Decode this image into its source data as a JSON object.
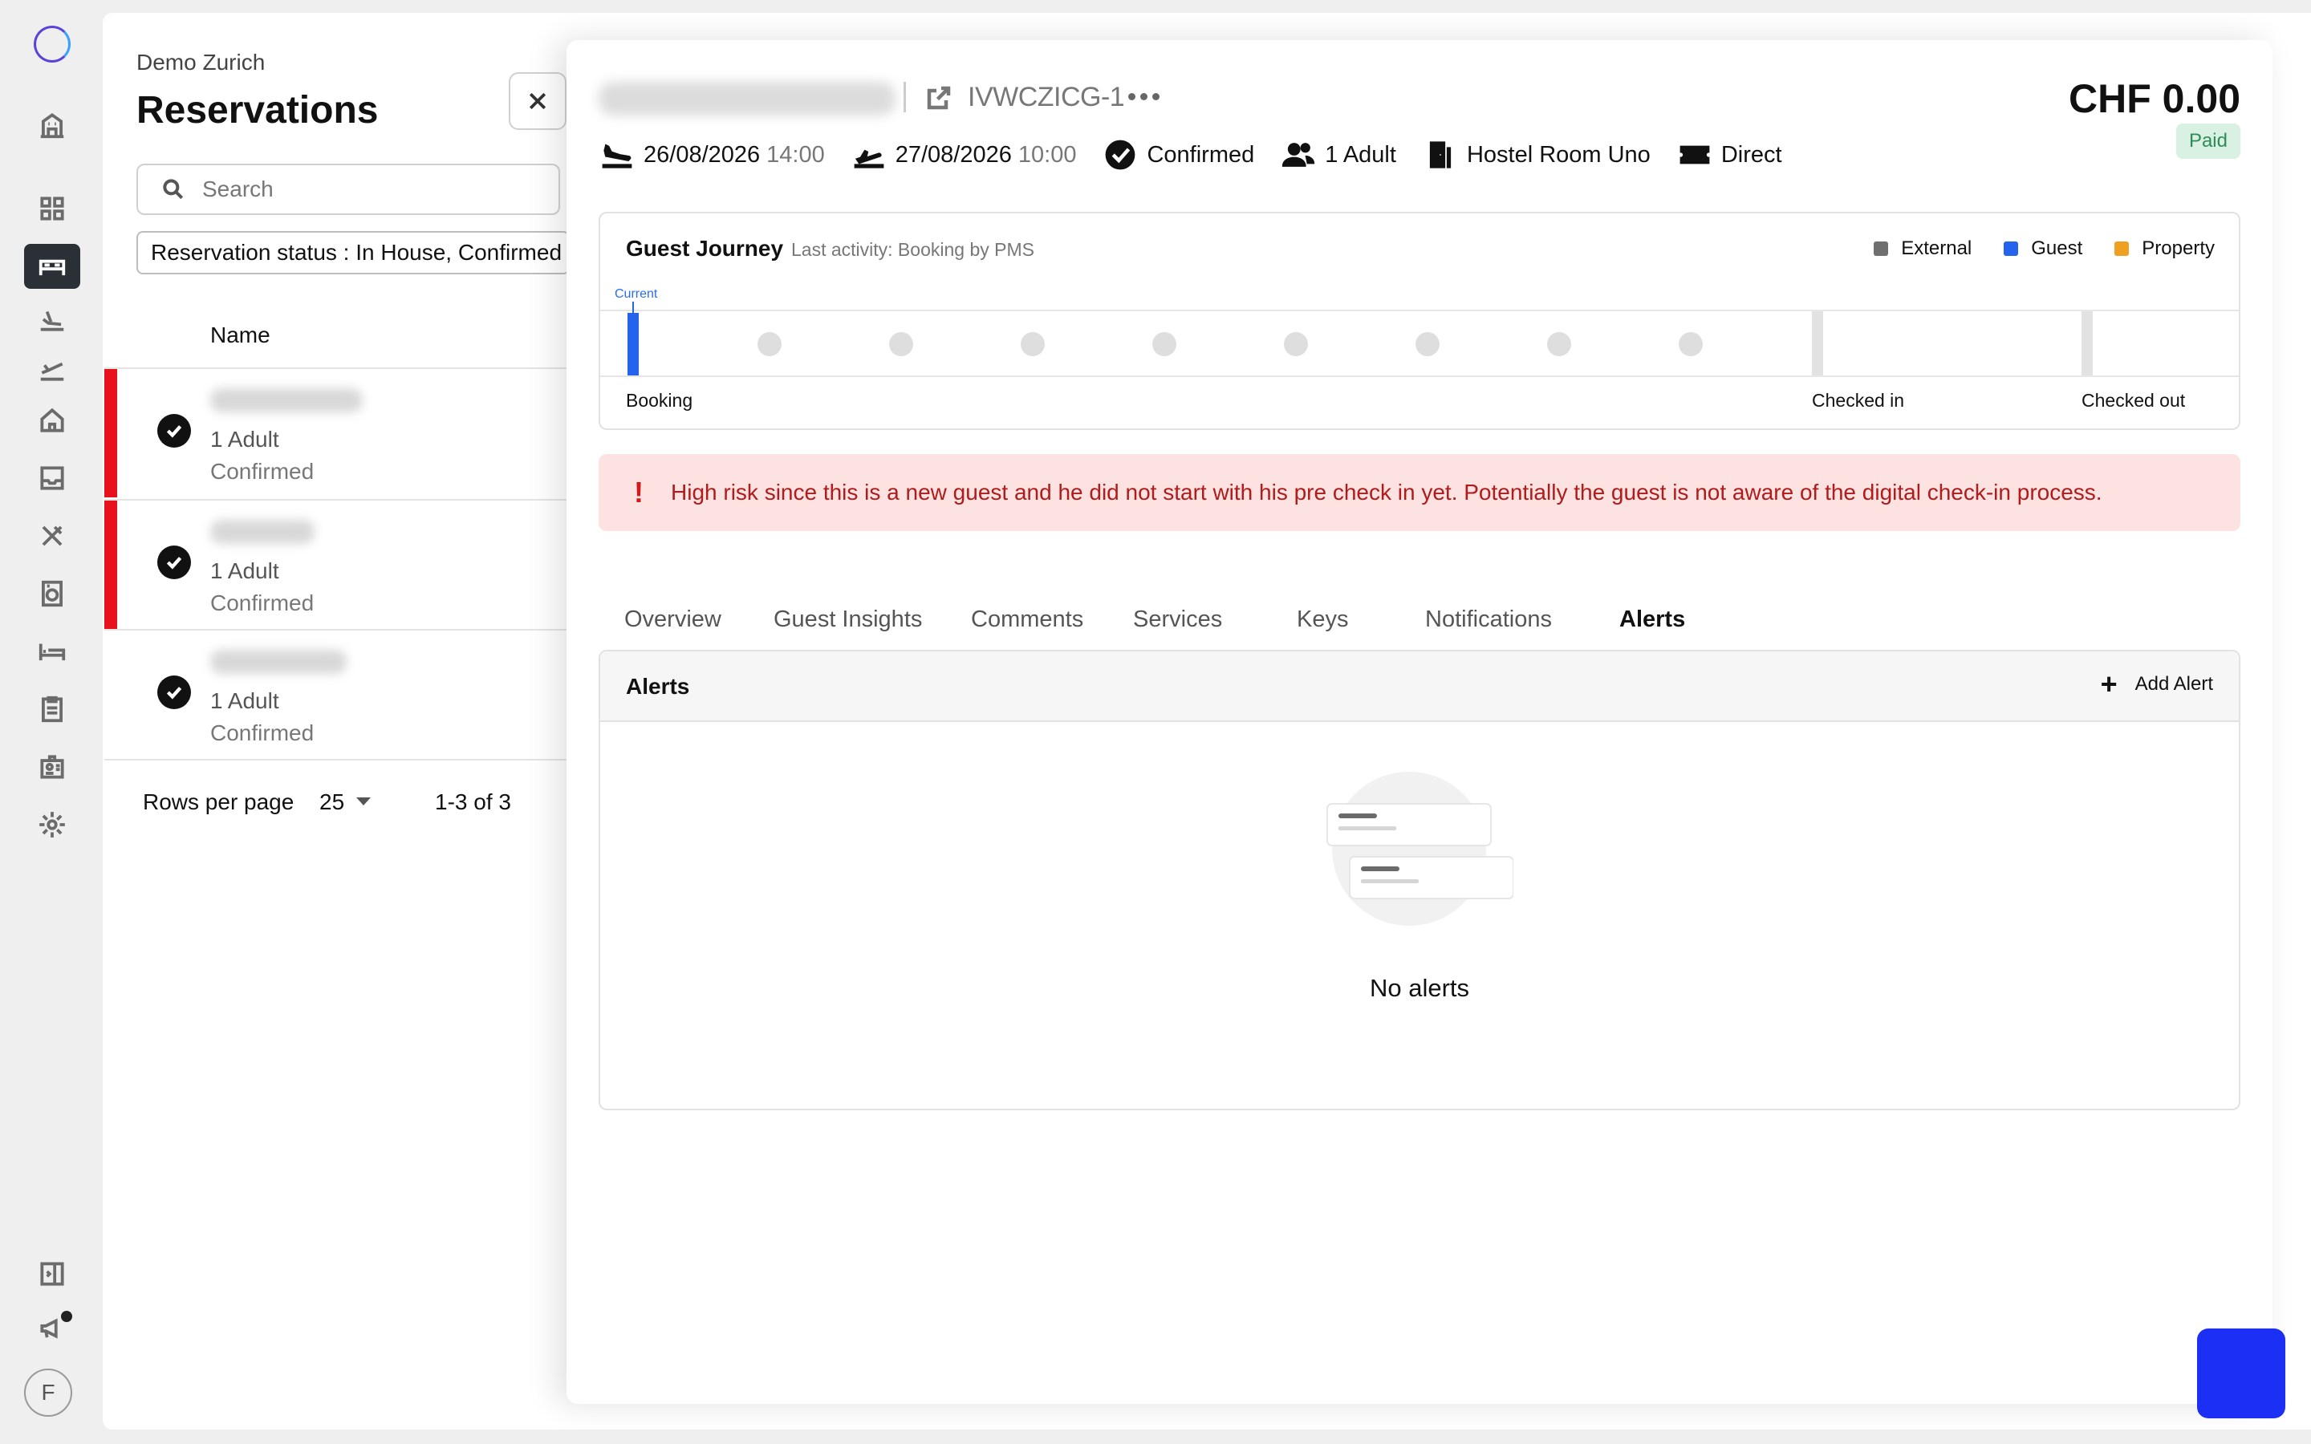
{
  "sidebar": {
    "icons": [
      "logo-icon",
      "building-icon",
      "grid-icon",
      "bed-icon",
      "arrival-icon",
      "departure-icon",
      "home-icon",
      "inbox-icon",
      "utensils-icon",
      "laundry-icon",
      "bed-alt-icon",
      "clipboard-icon",
      "id-card-icon",
      "gear-icon",
      "sidebar-toggle-icon",
      "megaphone-icon"
    ],
    "active": "bed-icon",
    "avatar_initial": "F"
  },
  "list": {
    "hotel": "Demo Zurich",
    "title": "Reservations",
    "search_placeholder": "Search",
    "filter_label": "Reservation status : In House, Confirmed",
    "column_name": "Name",
    "rows": [
      {
        "guests": "1 Adult",
        "status": "Confirmed",
        "high_risk": true
      },
      {
        "guests": "1 Adult",
        "status": "Confirmed",
        "high_risk": true
      },
      {
        "guests": "1 Adult",
        "status": "Confirmed",
        "high_risk": false
      }
    ],
    "rows_per_page_label": "Rows per page",
    "rows_per_page_value": "25",
    "paging": "1-3 of 3"
  },
  "detail": {
    "reservation_code": "IVWCZICG-1",
    "price": "CHF 0.00",
    "payment_status": "Paid",
    "arrival_date": "26/08/2026",
    "arrival_time": "14:00",
    "departure_date": "27/08/2026",
    "departure_time": "10:00",
    "status": "Confirmed",
    "guests": "1 Adult",
    "room": "Hostel Room Uno",
    "channel": "Direct",
    "journey": {
      "title": "Guest Journey",
      "last_activity": "Last activity: Booking by PMS",
      "legend": [
        {
          "label": "External",
          "color": "#6f6f6f"
        },
        {
          "label": "Guest",
          "color": "#2463eb"
        },
        {
          "label": "Property",
          "color": "#f0a020"
        }
      ],
      "current_label": "Current",
      "stages": [
        "Booking",
        "Checked in",
        "Checked out"
      ]
    },
    "risk_message": "High risk since this is a new guest and he did not start with his pre check in yet. Potentially the guest is not aware of the digital check-in process.",
    "tabs": [
      "Overview",
      "Guest Insights",
      "Comments",
      "Services",
      "Keys",
      "Notifications",
      "Alerts"
    ],
    "active_tab": "Alerts",
    "alerts": {
      "title": "Alerts",
      "add_label": "Add Alert",
      "empty_text": "No alerts"
    }
  }
}
